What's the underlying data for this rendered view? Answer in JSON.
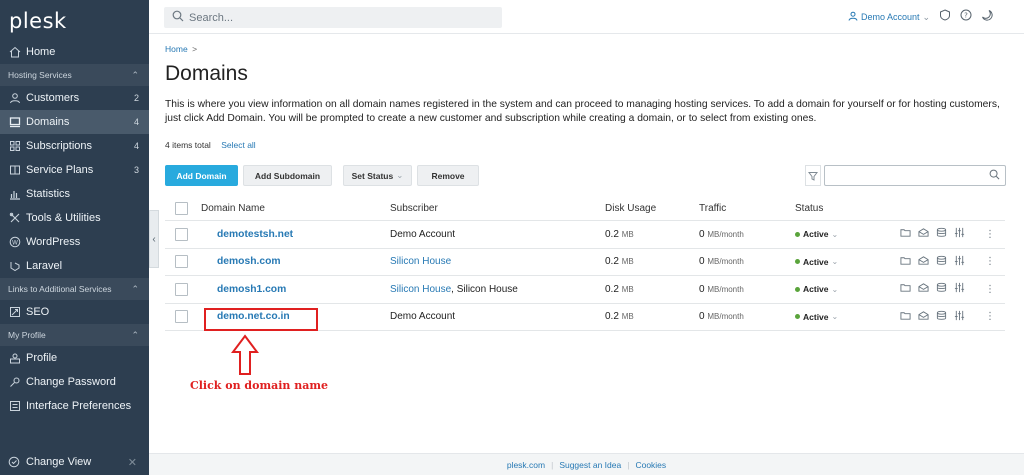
{
  "app": {
    "logo": "plesk"
  },
  "sidebar": {
    "home": "Home",
    "sections": [
      {
        "label": "Hosting Services"
      },
      {
        "label": "Links to Additional Services"
      },
      {
        "label": "My Profile"
      }
    ],
    "hosting_items": [
      {
        "label": "Customers",
        "count": "2",
        "icon": "person-icon"
      },
      {
        "label": "Domains",
        "count": "4",
        "icon": "monitor-icon"
      },
      {
        "label": "Subscriptions",
        "count": "4",
        "icon": "grid-icon"
      },
      {
        "label": "Service Plans",
        "count": "3",
        "icon": "book-icon"
      },
      {
        "label": "Statistics",
        "icon": "bar-chart-icon"
      },
      {
        "label": "Tools & Utilities",
        "icon": "tools-icon"
      },
      {
        "label": "WordPress",
        "icon": "wordpress-icon"
      },
      {
        "label": "Laravel",
        "icon": "laravel-icon"
      }
    ],
    "additional_items": [
      {
        "label": "SEO",
        "icon": "chart-up-icon"
      }
    ],
    "profile_items": [
      {
        "label": "Profile",
        "icon": "profile-icon"
      },
      {
        "label": "Change Password",
        "icon": "key-icon"
      },
      {
        "label": "Interface Preferences",
        "icon": "preferences-icon"
      }
    ],
    "change_view": "Change View"
  },
  "topbar": {
    "search_placeholder": "Search...",
    "account": "Demo Account"
  },
  "breadcrumb": {
    "home": "Home",
    "sep": ">"
  },
  "page": {
    "title": "Domains",
    "intro": "This is where you view information on all domain names registered in the system and can proceed to managing hosting services. To add a domain for yourself or for hosting customers, just click Add Domain. You will be prompted to create a new customer and subscription while creating a domain, or to select from existing ones.",
    "items_total": "4 items total",
    "select_all": "Select all"
  },
  "toolbar": {
    "add_domain": "Add Domain",
    "add_subdomain": "Add Subdomain",
    "set_status": "Set Status",
    "remove": "Remove"
  },
  "table": {
    "headers": {
      "name": "Domain Name",
      "subscriber": "Subscriber",
      "disk": "Disk Usage",
      "traffic": "Traffic",
      "status": "Status"
    },
    "rows": [
      {
        "domain": "demotestsh.net",
        "subscriber": "Demo Account",
        "subscriber_link": false,
        "disk": "0.2",
        "disk_unit": "MB",
        "traffic": "0",
        "traffic_unit": "MB/month",
        "status": "Active"
      },
      {
        "domain": "demosh.com",
        "subscriber": "Silicon House",
        "subscriber_link": true,
        "disk": "0.2",
        "disk_unit": "MB",
        "traffic": "0",
        "traffic_unit": "MB/month",
        "status": "Active"
      },
      {
        "domain": "demosh1.com",
        "subscriber": "Silicon House",
        "subscriber_extra": ", Silicon House",
        "subscriber_link": true,
        "disk": "0.2",
        "disk_unit": "MB",
        "traffic": "0",
        "traffic_unit": "MB/month",
        "status": "Active"
      },
      {
        "domain": "demo.net.co.in",
        "subscriber": "Demo Account",
        "subscriber_link": false,
        "disk": "0.2",
        "disk_unit": "MB",
        "traffic": "0",
        "traffic_unit": "MB/month",
        "status": "Active"
      }
    ]
  },
  "annotation": {
    "text": "Click on domain name",
    "color": "#e02020"
  },
  "footer": {
    "links": [
      "plesk.com",
      "Suggest an Idea",
      "Cookies"
    ]
  },
  "colors": {
    "sidebar": "#2d3e50",
    "accent": "#28aade",
    "link": "#2779b4",
    "active_dot": "#5aa43b"
  }
}
